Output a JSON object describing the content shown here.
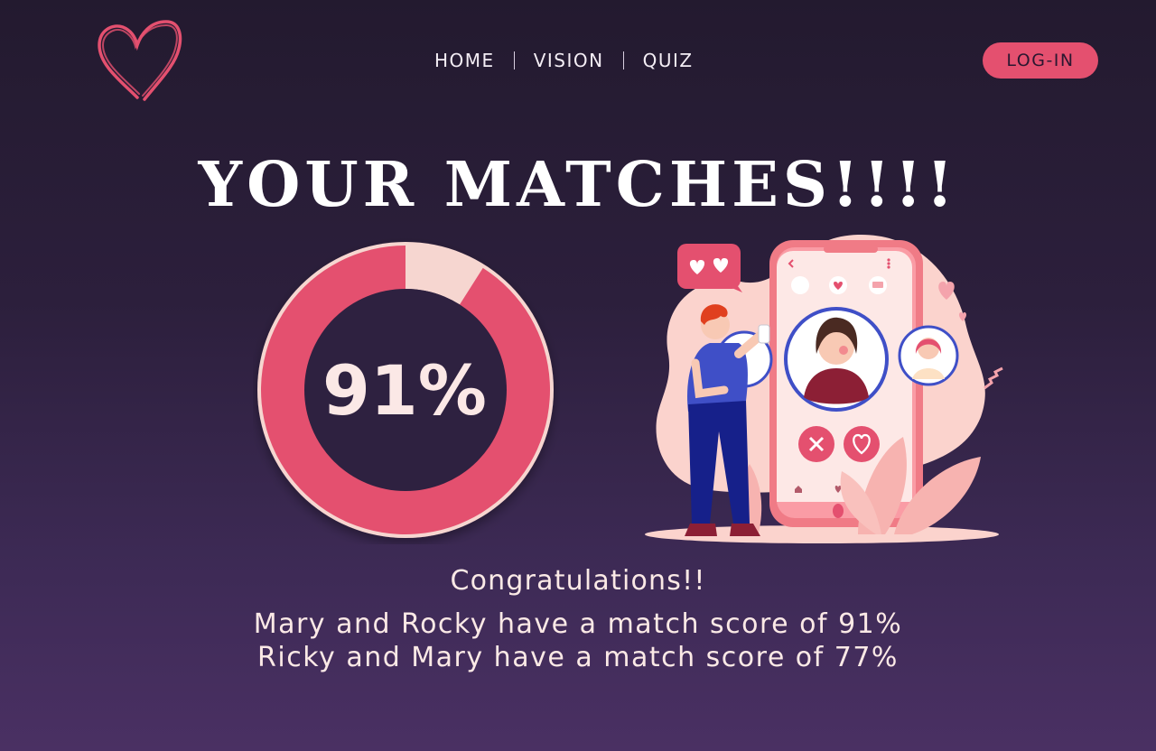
{
  "nav": {
    "items": [
      {
        "label": "HOME"
      },
      {
        "label": "VISION"
      },
      {
        "label": "QUIZ"
      }
    ],
    "login_label": "LOG-IN"
  },
  "page_title": "YOUR MATCHES!!!!",
  "match_ring": {
    "label": "91%",
    "value_percent": 91
  },
  "congrats": "Congratulations!!",
  "scores": [
    "Mary and Rocky have a match score of 91%",
    "Ricky and Mary have a match score of 77%"
  ],
  "colors": {
    "accent": "#e4506f",
    "ring_track": "#f6d6d0",
    "text_light": "#fbe9e6"
  },
  "icons": {
    "logo": "heart-outline-icon",
    "illustration": "dating-app-phone-illustration"
  }
}
